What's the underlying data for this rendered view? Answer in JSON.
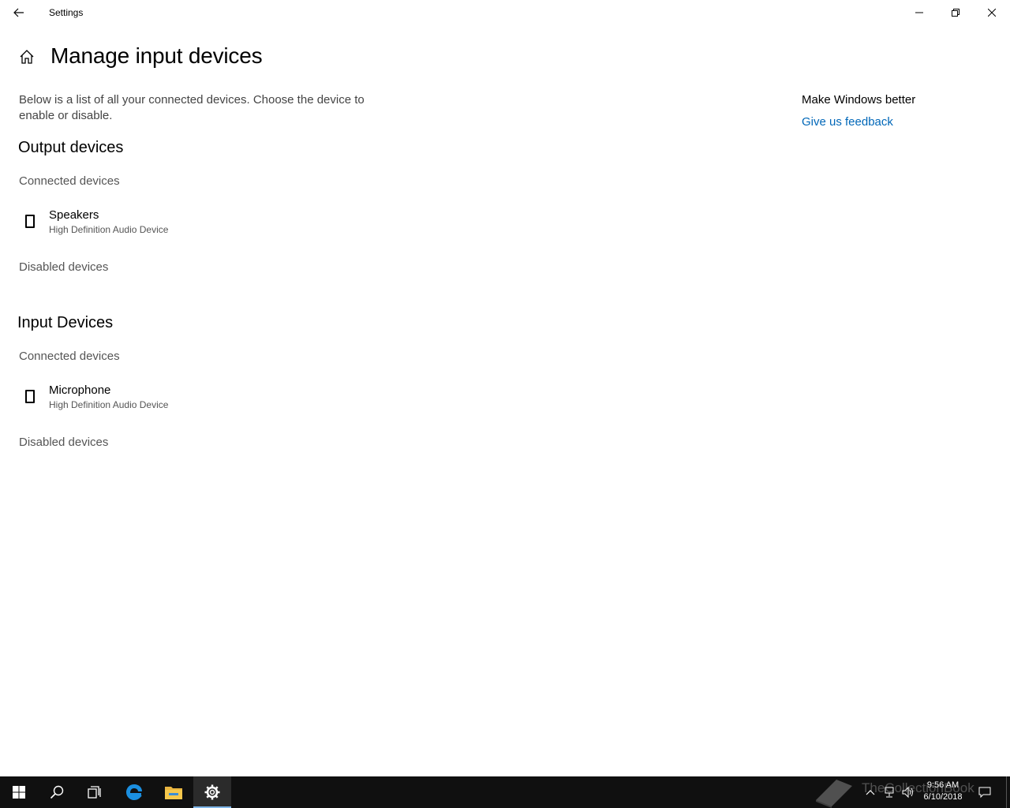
{
  "window": {
    "title": "Settings"
  },
  "page": {
    "title": "Manage input devices",
    "description": "Below is a list of all your connected devices. Choose the device to enable or disable."
  },
  "output": {
    "title": "Output devices",
    "connected_label": "Connected devices",
    "devices": [
      {
        "name": "Speakers",
        "description": "High Definition Audio Device"
      }
    ],
    "disabled_label": "Disabled devices"
  },
  "input": {
    "title": "Input Devices",
    "connected_label": "Connected devices",
    "devices": [
      {
        "name": "Microphone",
        "description": "High Definition Audio Device"
      }
    ],
    "disabled_label": "Disabled devices"
  },
  "sidebar": {
    "title": "Make Windows better",
    "feedback_link": "Give us feedback"
  },
  "taskbar": {
    "items": [
      {
        "icon": "windows-start-icon"
      },
      {
        "icon": "search-icon"
      },
      {
        "icon": "task-view-icon"
      },
      {
        "icon": "edge-browser-icon"
      },
      {
        "icon": "file-explorer-icon"
      },
      {
        "icon": "settings-gear-icon",
        "active": true
      }
    ],
    "clock": {
      "time": "9:56 AM",
      "date": "6/10/2018"
    },
    "watermark": "TheCollectionBook",
    "accent_color": "#7fb6e8"
  },
  "colors": {
    "link": "#0067b8",
    "taskbar_bg": "#101010"
  }
}
